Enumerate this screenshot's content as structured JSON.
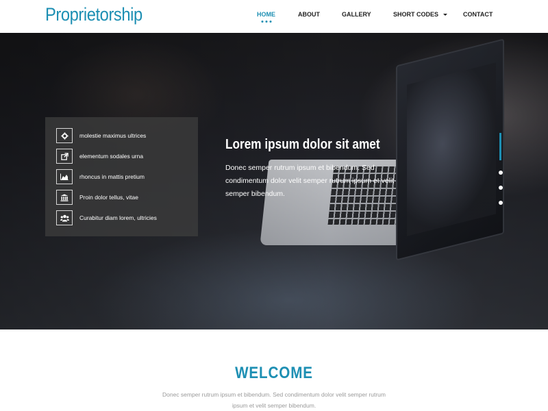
{
  "header": {
    "logo": "Proprietorship",
    "nav": [
      {
        "label": "HOME",
        "active": true
      },
      {
        "label": "ABOUT",
        "active": false
      },
      {
        "label": "GALLERY",
        "active": false
      },
      {
        "label": "SHORT CODES",
        "active": false,
        "has_dropdown": true
      },
      {
        "label": "CONTACT",
        "active": false
      }
    ]
  },
  "hero": {
    "title": "Lorem ipsum dolor sit amet",
    "text": "Donec semper rutrum ipsum et bibendum. Sed condimentum dolor velit semper rutrum ipsum et velit semper bibendum.",
    "features": [
      {
        "icon": "gear-icon",
        "label": "molestie maximus ultrices"
      },
      {
        "icon": "external-link-icon",
        "label": "elementum sodales urna"
      },
      {
        "icon": "area-chart-icon",
        "label": "rhoncus in mattis pretium"
      },
      {
        "icon": "bank-icon",
        "label": "Proin dolor tellus, vitae"
      },
      {
        "icon": "users-icon",
        "label": "Curabitur diam lorem, ultricies"
      }
    ],
    "slider": {
      "slides": 4,
      "active_index": 0
    }
  },
  "welcome": {
    "title": "WELCOME",
    "text": "Donec semper rutrum ipsum et bibendum. Sed condimentum dolor velit semper rutrum ipsum et velit semper bibendum."
  },
  "colors": {
    "accent": "#1d8fb3",
    "nav_text": "#222222",
    "muted_text": "#9a9a9a",
    "panel_bg": "#3c3c3c"
  }
}
